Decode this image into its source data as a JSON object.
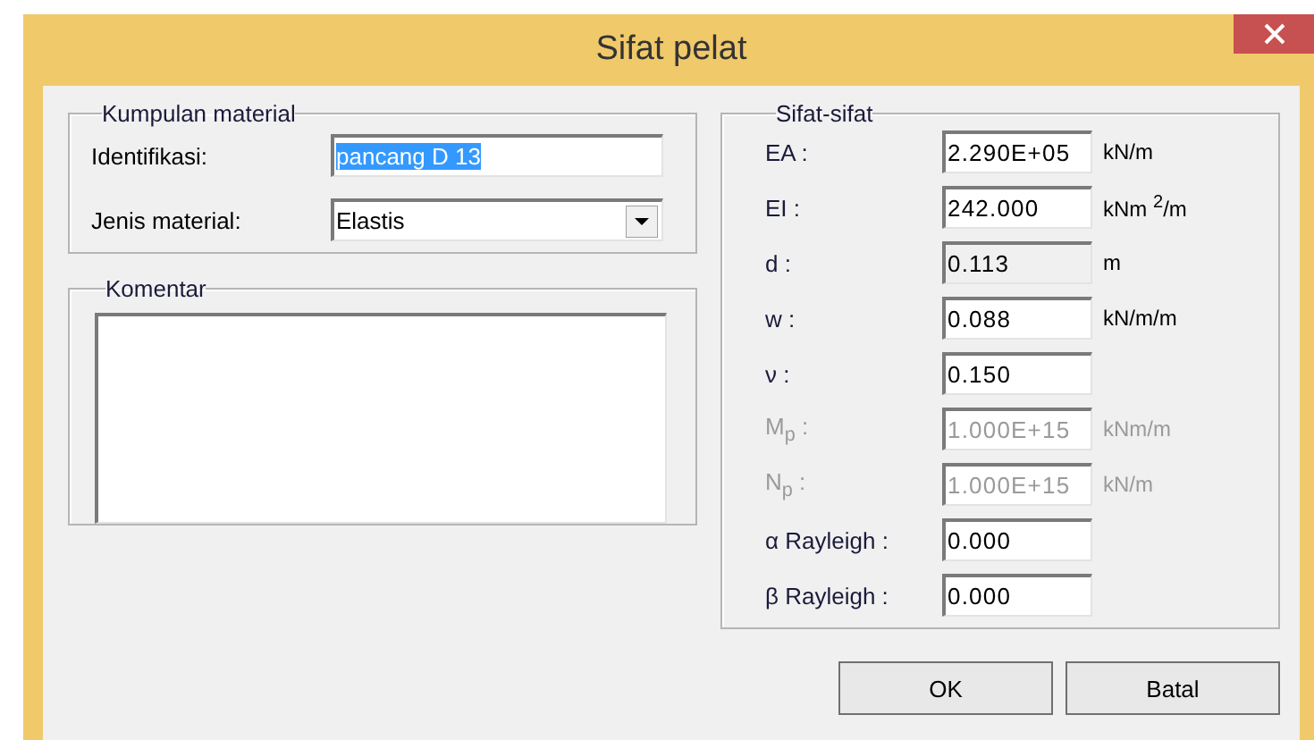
{
  "window": {
    "title": "Sifat pelat"
  },
  "material_group": {
    "title": "Kumpulan material",
    "identification": {
      "label": "Identifikasi:",
      "value": "pancang D 13",
      "text_selected": true
    },
    "material_type": {
      "label": "Jenis material:",
      "value": "Elastis"
    }
  },
  "comment_group": {
    "title": "Komentar"
  },
  "properties_group": {
    "title": "Sifat-sifat",
    "rows": [
      {
        "label": "EA :",
        "value": "2.290E+05",
        "unit": "kN/m",
        "disabled": false,
        "read_only": false
      },
      {
        "label": "EI :",
        "value": "242.000",
        "unit": "kNm $^{2}$/m",
        "disabled": false,
        "read_only": false
      },
      {
        "label": "d :",
        "value": "0.113",
        "unit": "m",
        "disabled": false,
        "read_only": true
      },
      {
        "label": "w :",
        "value": "0.088",
        "unit": "kN/m/m",
        "disabled": false,
        "read_only": false
      },
      {
        "label": "ν :",
        "value": "0.150",
        "disabled": false,
        "read_only": false
      },
      {
        "label": "M$_{p}$ :",
        "value": "1.000E+15",
        "unit": "kNm/m",
        "disabled": true,
        "read_only": false
      },
      {
        "label": "N$_{p}$ :",
        "value": "1.000E+15",
        "unit": "kN/m",
        "disabled": true,
        "read_only": false
      },
      {
        "label": "α Rayleigh :",
        "value": "0.000",
        "disabled": false,
        "read_only": false
      },
      {
        "label": "β Rayleigh :",
        "value": "0.000",
        "disabled": false,
        "read_only": false
      }
    ]
  },
  "buttons": [
    {
      "label": "OK"
    },
    {
      "label": "Batal"
    }
  ]
}
